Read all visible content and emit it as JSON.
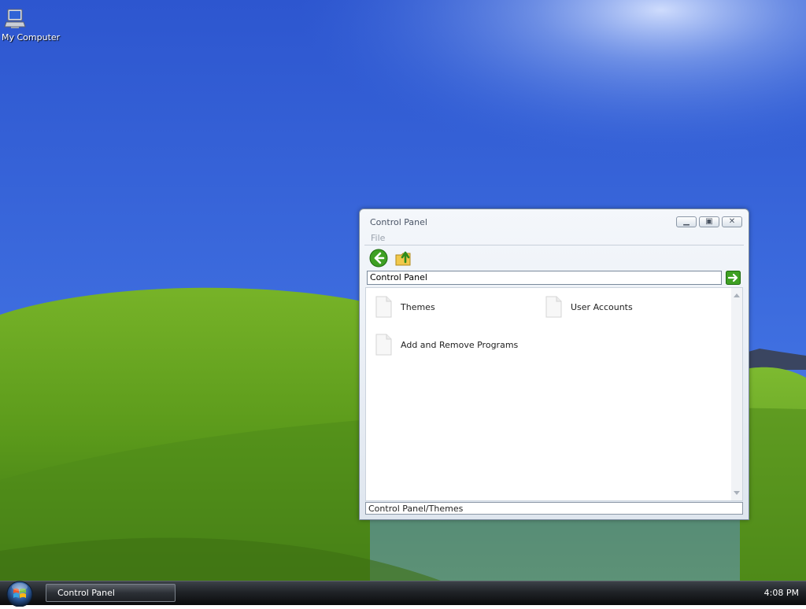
{
  "desktop": {
    "icons": [
      {
        "label": "My Computer",
        "icon": "my-computer-icon"
      }
    ]
  },
  "window": {
    "title": "Control Panel",
    "controls": {
      "minimize": "minimize",
      "maximize": "maximize",
      "close": "close"
    },
    "menu": [
      "File"
    ],
    "toolbar": {
      "back": "back-arrow-icon",
      "up": "up-folder-icon"
    },
    "address": "Control Panel",
    "go": "go-arrow-icon",
    "items": [
      {
        "label": "Themes",
        "icon": "document-icon"
      },
      {
        "label": "User Accounts",
        "icon": "document-icon"
      },
      {
        "label": "Add and Remove Programs",
        "icon": "document-icon"
      }
    ],
    "status": "Control Panel/Themes"
  },
  "taskbar": {
    "start": "start-orb-icon",
    "tasks": [
      {
        "label": "Control Panel"
      }
    ],
    "clock": "4:08 PM"
  },
  "colors": {
    "sky": "#3a66d8",
    "grass": "#5f9a1f",
    "accent_green": "#3ea023"
  }
}
